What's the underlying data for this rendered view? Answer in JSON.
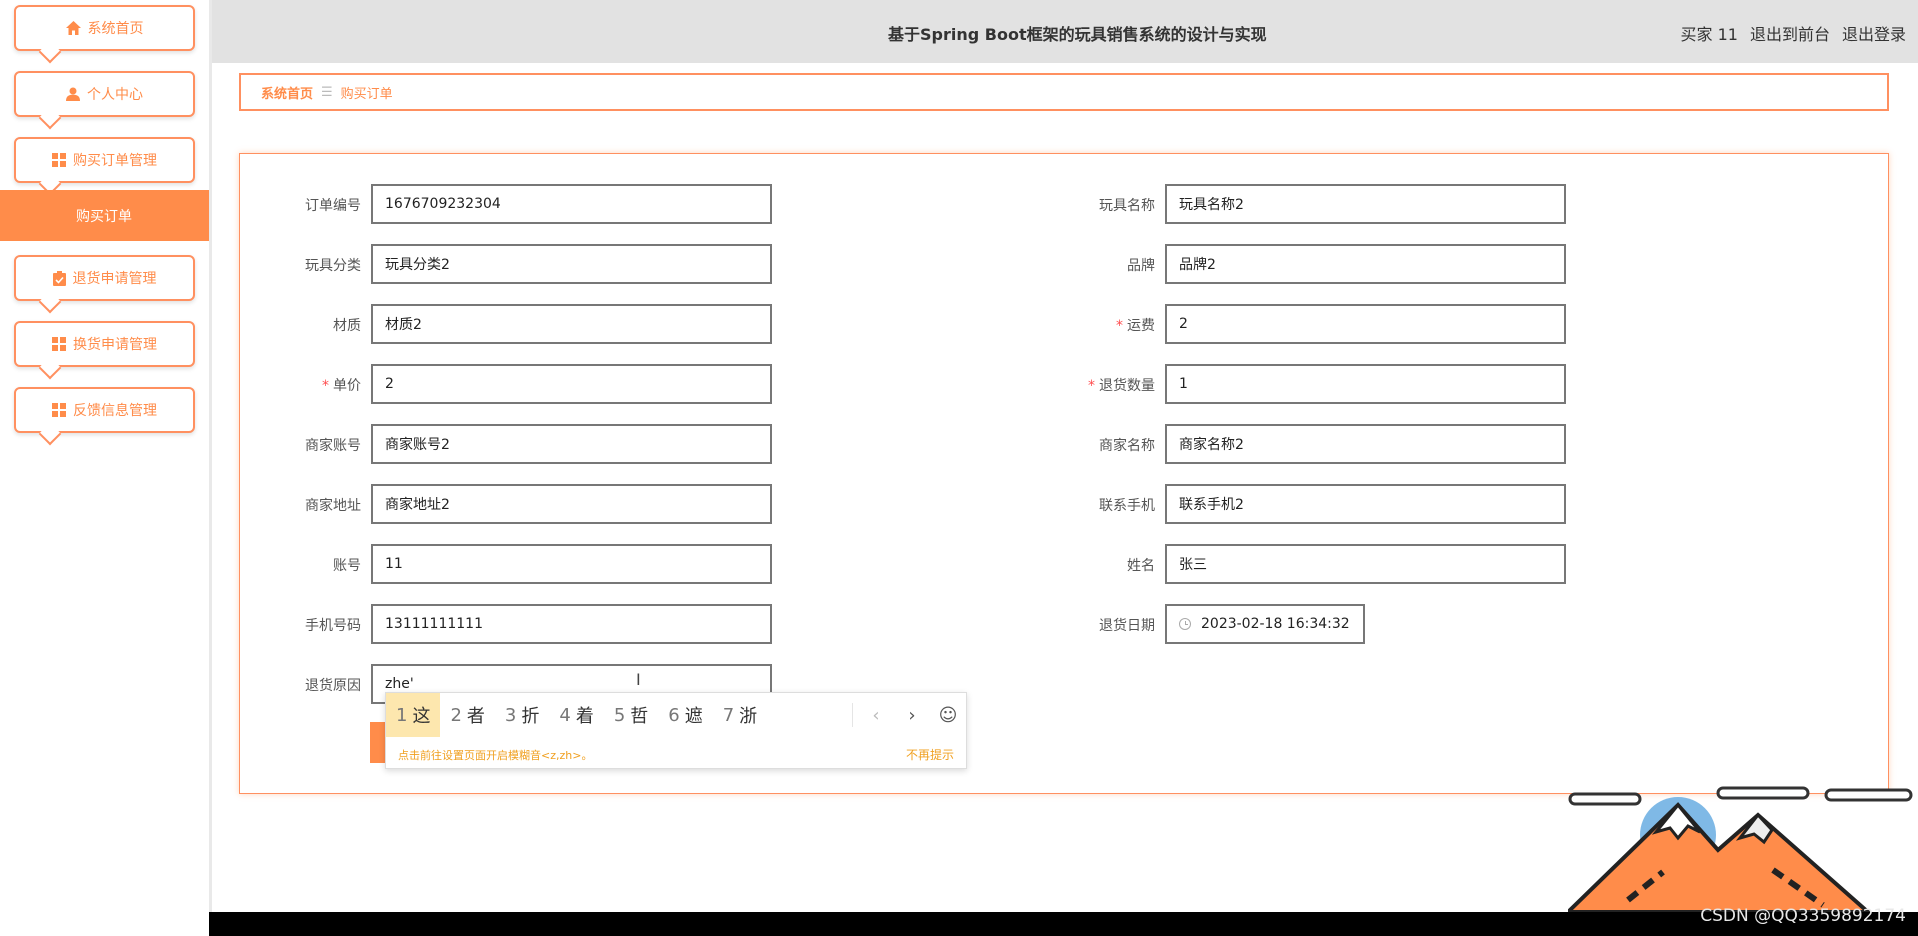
{
  "sidebar": {
    "items": [
      {
        "label": "系统首页",
        "icon": "home-icon"
      },
      {
        "label": "个人中心",
        "icon": "user-icon"
      },
      {
        "label": "购买订单管理",
        "icon": "grid-icon"
      },
      {
        "label": "退货申请管理",
        "icon": "clipboard-icon"
      },
      {
        "label": "换货申请管理",
        "icon": "grid-icon"
      },
      {
        "label": "反馈信息管理",
        "icon": "grid-icon"
      }
    ],
    "active_sub": "购买订单"
  },
  "header": {
    "title": "基于Spring Boot框架的玩具销售系统的设计与实现",
    "user": "买家 11",
    "to_front": "退出到前台",
    "logout": "退出登录"
  },
  "breadcrumb": {
    "home": "系统首页",
    "sep": "☰",
    "current": "购买订单"
  },
  "form": {
    "order_no": {
      "label": "订单编号",
      "value": "1676709232304"
    },
    "toy_name": {
      "label": "玩具名称",
      "value": "玩具名称2"
    },
    "toy_category": {
      "label": "玩具分类",
      "value": "玩具分类2"
    },
    "brand": {
      "label": "品牌",
      "value": "品牌2"
    },
    "material": {
      "label": "材质",
      "value": "材质2"
    },
    "shipping": {
      "label": "运费",
      "value": "2",
      "required": "*"
    },
    "unit_price": {
      "label": "单价",
      "value": "2",
      "required": "*"
    },
    "return_qty": {
      "label": "退货数量",
      "value": "1",
      "required": "*"
    },
    "merchant_account": {
      "label": "商家账号",
      "value": "商家账号2"
    },
    "merchant_name": {
      "label": "商家名称",
      "value": "商家名称2"
    },
    "merchant_address": {
      "label": "商家地址",
      "value": "商家地址2"
    },
    "contact_phone": {
      "label": "联系手机",
      "value": "联系手机2"
    },
    "account": {
      "label": "账号",
      "value": "11"
    },
    "name": {
      "label": "姓名",
      "value": "张三"
    },
    "mobile": {
      "label": "手机号码",
      "value": "13111111111"
    },
    "return_date": {
      "label": "退货日期",
      "value": "2023-02-18 16:34:32"
    },
    "return_reason": {
      "label": "退货原因",
      "value": "zhe'"
    }
  },
  "ime": {
    "candidates": [
      {
        "n": "1",
        "t": "这"
      },
      {
        "n": "2",
        "t": "者"
      },
      {
        "n": "3",
        "t": "折"
      },
      {
        "n": "4",
        "t": "着"
      },
      {
        "n": "5",
        "t": "哲"
      },
      {
        "n": "6",
        "t": "遮"
      },
      {
        "n": "7",
        "t": "浙"
      }
    ],
    "prev": "‹",
    "next": "›",
    "emoji": "☺",
    "tip": "点击前往设置页面开启模糊音<z,zh>。",
    "dismiss": "不再提示"
  },
  "watermark": "CSDN @QQ3359892174",
  "colors": {
    "accent": "#ff8c4a",
    "header_bg": "#e2e2e2"
  }
}
